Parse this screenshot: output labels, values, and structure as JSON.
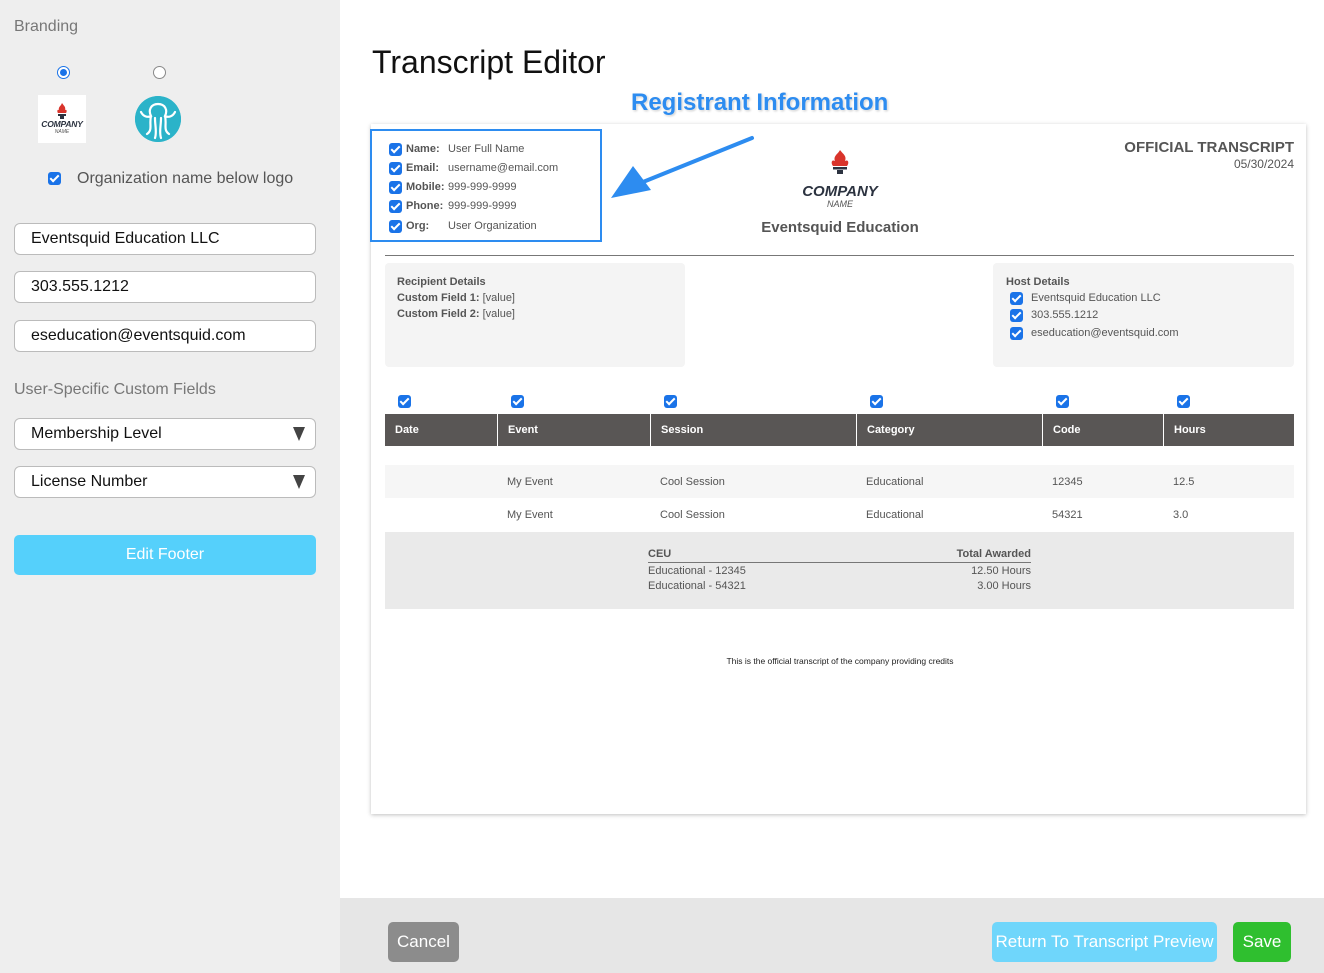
{
  "sidebar": {
    "branding_title": "Branding",
    "logo_option_1_text": "COMPANY",
    "logo_option_1_sub": "NAME",
    "org_name_below_logo_label": "Organization name below logo",
    "org_name_value": "Eventsquid Education LLC",
    "phone_value": "303.555.1212",
    "email_value": "eseducation@eventsquid.com",
    "custom_fields_title": "User-Specific Custom Fields",
    "custom_field_1": "Membership Level",
    "custom_field_2": "License Number",
    "edit_footer_label": "Edit Footer"
  },
  "main": {
    "title": "Transcript Editor",
    "annotation": "Registrant Information"
  },
  "transcript": {
    "registrant": {
      "name_label": "Name:",
      "name_value": "User Full Name",
      "email_label": "Email:",
      "email_value": "username@email.com",
      "mobile_label": "Mobile:",
      "mobile_value": "999-999-9999",
      "phone_label": "Phone:",
      "phone_value": "999-999-9999",
      "org_label": "Org:",
      "org_value": "User Organization"
    },
    "logo_text": "COMPANY",
    "logo_sub": "NAME",
    "org_title": "Eventsquid Education",
    "official_title": "OFFICIAL TRANSCRIPT",
    "date": "05/30/2024",
    "recipient": {
      "heading": "Recipient Details",
      "field1_label": "Custom Field 1:",
      "field1_value": "[value]",
      "field2_label": "Custom Field 2:",
      "field2_value": "[value]"
    },
    "host": {
      "heading": "Host Details",
      "org": "Eventsquid Education LLC",
      "phone": "303.555.1212",
      "email": "eseducation@eventsquid.com"
    },
    "columns": [
      "Date",
      "Event",
      "Session",
      "Category",
      "Code",
      "Hours"
    ],
    "rows": [
      {
        "date": "",
        "event": "My Event",
        "session": "Cool Session",
        "category": "Educational",
        "code": "12345",
        "hours": "12.5"
      },
      {
        "date": "",
        "event": "My Event",
        "session": "Cool Session",
        "category": "Educational",
        "code": "54321",
        "hours": "3.0"
      }
    ],
    "ceu": {
      "heading": "CEU",
      "total_heading": "Total Awarded",
      "items": [
        {
          "label": "Educational - 12345",
          "hours": "12.50 Hours"
        },
        {
          "label": "Educational - 54321",
          "hours": "3.00 Hours"
        }
      ]
    },
    "footer_note": "This is the official transcript of the company providing credits"
  },
  "actions": {
    "cancel": "Cancel",
    "return_preview": "Return To Transcript Preview",
    "save": "Save"
  },
  "colors": {
    "accent_blue": "#1a73e8",
    "annotation_blue": "#2d8cf0",
    "table_header": "#595655",
    "save_green": "#2fbf2f",
    "edit_footer_cyan": "#55d0fb"
  }
}
